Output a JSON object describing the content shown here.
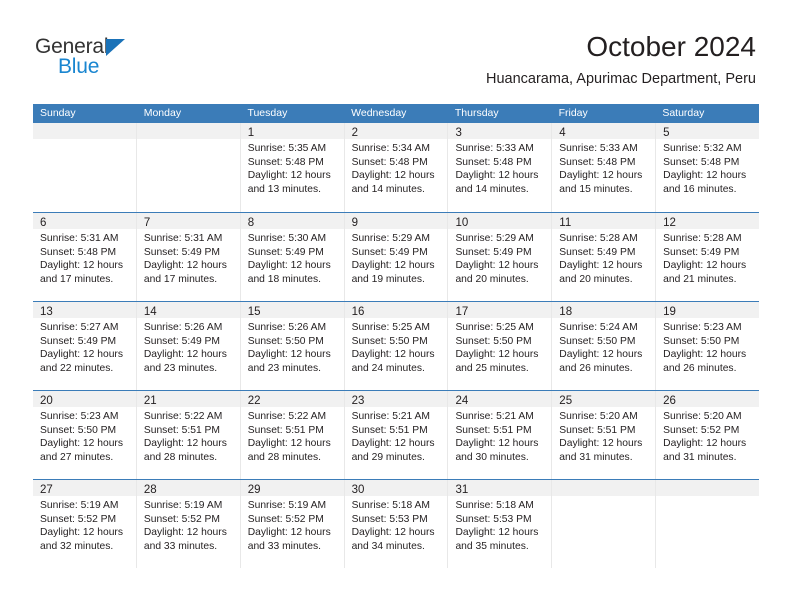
{
  "brand": {
    "name_top": "General",
    "name_bottom": "Blue",
    "triangle_icon": "triangle-icon",
    "color_dark": "#333333",
    "color_blue": "#1a86d0"
  },
  "header": {
    "month_title": "October 2024",
    "location": "Huancarama, Apurimac Department, Peru"
  },
  "theme": {
    "header_blue": "#3b7cb8",
    "daynum_band": "#f1f1f1",
    "cell_border": "#e8e8e8",
    "text": "#231f20"
  },
  "calendar": {
    "weekdays": [
      "Sunday",
      "Monday",
      "Tuesday",
      "Wednesday",
      "Thursday",
      "Friday",
      "Saturday"
    ],
    "weeks": [
      [
        {
          "day": "",
          "sunrise": "",
          "sunset": "",
          "daylight1": "",
          "daylight2": ""
        },
        {
          "day": "",
          "sunrise": "",
          "sunset": "",
          "daylight1": "",
          "daylight2": ""
        },
        {
          "day": "1",
          "sunrise": "Sunrise: 5:35 AM",
          "sunset": "Sunset: 5:48 PM",
          "daylight1": "Daylight: 12 hours",
          "daylight2": "and 13 minutes."
        },
        {
          "day": "2",
          "sunrise": "Sunrise: 5:34 AM",
          "sunset": "Sunset: 5:48 PM",
          "daylight1": "Daylight: 12 hours",
          "daylight2": "and 14 minutes."
        },
        {
          "day": "3",
          "sunrise": "Sunrise: 5:33 AM",
          "sunset": "Sunset: 5:48 PM",
          "daylight1": "Daylight: 12 hours",
          "daylight2": "and 14 minutes."
        },
        {
          "day": "4",
          "sunrise": "Sunrise: 5:33 AM",
          "sunset": "Sunset: 5:48 PM",
          "daylight1": "Daylight: 12 hours",
          "daylight2": "and 15 minutes."
        },
        {
          "day": "5",
          "sunrise": "Sunrise: 5:32 AM",
          "sunset": "Sunset: 5:48 PM",
          "daylight1": "Daylight: 12 hours",
          "daylight2": "and 16 minutes."
        }
      ],
      [
        {
          "day": "6",
          "sunrise": "Sunrise: 5:31 AM",
          "sunset": "Sunset: 5:48 PM",
          "daylight1": "Daylight: 12 hours",
          "daylight2": "and 17 minutes."
        },
        {
          "day": "7",
          "sunrise": "Sunrise: 5:31 AM",
          "sunset": "Sunset: 5:49 PM",
          "daylight1": "Daylight: 12 hours",
          "daylight2": "and 17 minutes."
        },
        {
          "day": "8",
          "sunrise": "Sunrise: 5:30 AM",
          "sunset": "Sunset: 5:49 PM",
          "daylight1": "Daylight: 12 hours",
          "daylight2": "and 18 minutes."
        },
        {
          "day": "9",
          "sunrise": "Sunrise: 5:29 AM",
          "sunset": "Sunset: 5:49 PM",
          "daylight1": "Daylight: 12 hours",
          "daylight2": "and 19 minutes."
        },
        {
          "day": "10",
          "sunrise": "Sunrise: 5:29 AM",
          "sunset": "Sunset: 5:49 PM",
          "daylight1": "Daylight: 12 hours",
          "daylight2": "and 20 minutes."
        },
        {
          "day": "11",
          "sunrise": "Sunrise: 5:28 AM",
          "sunset": "Sunset: 5:49 PM",
          "daylight1": "Daylight: 12 hours",
          "daylight2": "and 20 minutes."
        },
        {
          "day": "12",
          "sunrise": "Sunrise: 5:28 AM",
          "sunset": "Sunset: 5:49 PM",
          "daylight1": "Daylight: 12 hours",
          "daylight2": "and 21 minutes."
        }
      ],
      [
        {
          "day": "13",
          "sunrise": "Sunrise: 5:27 AM",
          "sunset": "Sunset: 5:49 PM",
          "daylight1": "Daylight: 12 hours",
          "daylight2": "and 22 minutes."
        },
        {
          "day": "14",
          "sunrise": "Sunrise: 5:26 AM",
          "sunset": "Sunset: 5:49 PM",
          "daylight1": "Daylight: 12 hours",
          "daylight2": "and 23 minutes."
        },
        {
          "day": "15",
          "sunrise": "Sunrise: 5:26 AM",
          "sunset": "Sunset: 5:50 PM",
          "daylight1": "Daylight: 12 hours",
          "daylight2": "and 23 minutes."
        },
        {
          "day": "16",
          "sunrise": "Sunrise: 5:25 AM",
          "sunset": "Sunset: 5:50 PM",
          "daylight1": "Daylight: 12 hours",
          "daylight2": "and 24 minutes."
        },
        {
          "day": "17",
          "sunrise": "Sunrise: 5:25 AM",
          "sunset": "Sunset: 5:50 PM",
          "daylight1": "Daylight: 12 hours",
          "daylight2": "and 25 minutes."
        },
        {
          "day": "18",
          "sunrise": "Sunrise: 5:24 AM",
          "sunset": "Sunset: 5:50 PM",
          "daylight1": "Daylight: 12 hours",
          "daylight2": "and 26 minutes."
        },
        {
          "day": "19",
          "sunrise": "Sunrise: 5:23 AM",
          "sunset": "Sunset: 5:50 PM",
          "daylight1": "Daylight: 12 hours",
          "daylight2": "and 26 minutes."
        }
      ],
      [
        {
          "day": "20",
          "sunrise": "Sunrise: 5:23 AM",
          "sunset": "Sunset: 5:50 PM",
          "daylight1": "Daylight: 12 hours",
          "daylight2": "and 27 minutes."
        },
        {
          "day": "21",
          "sunrise": "Sunrise: 5:22 AM",
          "sunset": "Sunset: 5:51 PM",
          "daylight1": "Daylight: 12 hours",
          "daylight2": "and 28 minutes."
        },
        {
          "day": "22",
          "sunrise": "Sunrise: 5:22 AM",
          "sunset": "Sunset: 5:51 PM",
          "daylight1": "Daylight: 12 hours",
          "daylight2": "and 28 minutes."
        },
        {
          "day": "23",
          "sunrise": "Sunrise: 5:21 AM",
          "sunset": "Sunset: 5:51 PM",
          "daylight1": "Daylight: 12 hours",
          "daylight2": "and 29 minutes."
        },
        {
          "day": "24",
          "sunrise": "Sunrise: 5:21 AM",
          "sunset": "Sunset: 5:51 PM",
          "daylight1": "Daylight: 12 hours",
          "daylight2": "and 30 minutes."
        },
        {
          "day": "25",
          "sunrise": "Sunrise: 5:20 AM",
          "sunset": "Sunset: 5:51 PM",
          "daylight1": "Daylight: 12 hours",
          "daylight2": "and 31 minutes."
        },
        {
          "day": "26",
          "sunrise": "Sunrise: 5:20 AM",
          "sunset": "Sunset: 5:52 PM",
          "daylight1": "Daylight: 12 hours",
          "daylight2": "and 31 minutes."
        }
      ],
      [
        {
          "day": "27",
          "sunrise": "Sunrise: 5:19 AM",
          "sunset": "Sunset: 5:52 PM",
          "daylight1": "Daylight: 12 hours",
          "daylight2": "and 32 minutes."
        },
        {
          "day": "28",
          "sunrise": "Sunrise: 5:19 AM",
          "sunset": "Sunset: 5:52 PM",
          "daylight1": "Daylight: 12 hours",
          "daylight2": "and 33 minutes."
        },
        {
          "day": "29",
          "sunrise": "Sunrise: 5:19 AM",
          "sunset": "Sunset: 5:52 PM",
          "daylight1": "Daylight: 12 hours",
          "daylight2": "and 33 minutes."
        },
        {
          "day": "30",
          "sunrise": "Sunrise: 5:18 AM",
          "sunset": "Sunset: 5:53 PM",
          "daylight1": "Daylight: 12 hours",
          "daylight2": "and 34 minutes."
        },
        {
          "day": "31",
          "sunrise": "Sunrise: 5:18 AM",
          "sunset": "Sunset: 5:53 PM",
          "daylight1": "Daylight: 12 hours",
          "daylight2": "and 35 minutes."
        },
        {
          "day": "",
          "sunrise": "",
          "sunset": "",
          "daylight1": "",
          "daylight2": ""
        },
        {
          "day": "",
          "sunrise": "",
          "sunset": "",
          "daylight1": "",
          "daylight2": ""
        }
      ]
    ]
  }
}
